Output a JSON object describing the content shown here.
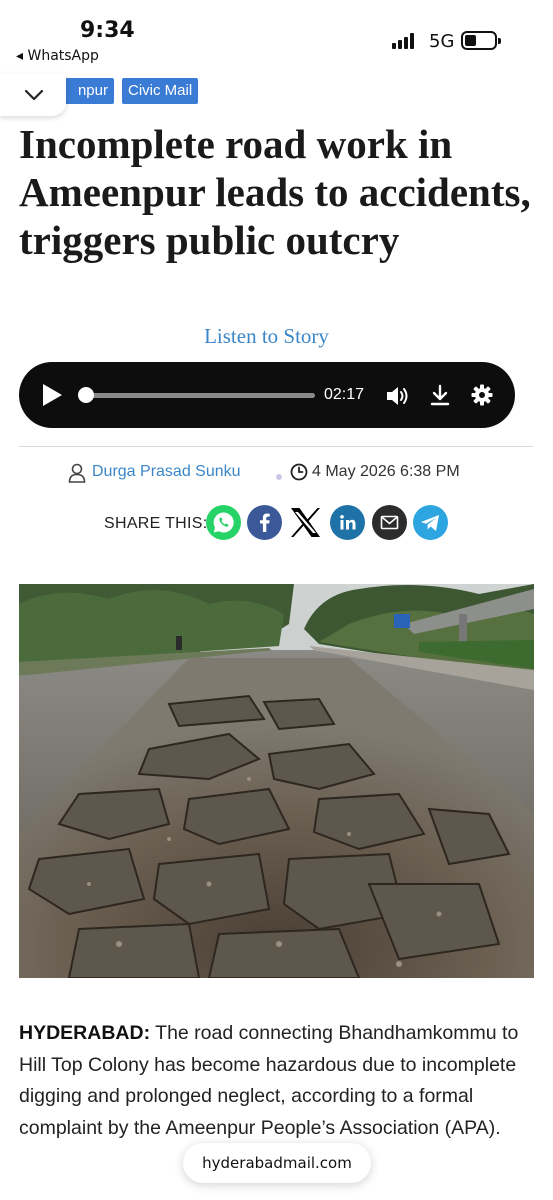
{
  "status_bar": {
    "time": "9:34",
    "back_app": "◂ WhatsApp",
    "network": "5G"
  },
  "categories": [
    "npur",
    "Civic Mail"
  ],
  "headline": "Incomplete road work in Ameenpur leads to accidents, triggers public outcry",
  "listen_label": "Listen to Story",
  "player": {
    "time": "02:17",
    "progress": 0.02
  },
  "meta": {
    "author": "Durga Prasad Sunku",
    "date": "4 May 2026 6:38 PM"
  },
  "share": {
    "label": "SHARE THIS:",
    "buttons": [
      {
        "name": "whatsapp",
        "color": "#25d366"
      },
      {
        "name": "facebook",
        "color": "#3b5998"
      },
      {
        "name": "x",
        "color": "#000000"
      },
      {
        "name": "linkedin",
        "color": "#0e76a8"
      },
      {
        "name": "email",
        "color": "#333333"
      },
      {
        "name": "telegram",
        "color": "#2ca5e0"
      }
    ]
  },
  "article": {
    "dateline": "HYDERABAD:",
    "text": " The road connecting Bhandhamkommu to Hill Top Colony has become hazardous due to incomplete digging and prolonged neglect, according to a formal complaint by the Ameenpur People’s Association (APA)."
  },
  "url_pill": "hyderabadmail.com",
  "colors": {
    "accent": "#3a86c8",
    "category_bg": "#3a7bd5",
    "player_bg": "#0d0d0d"
  }
}
